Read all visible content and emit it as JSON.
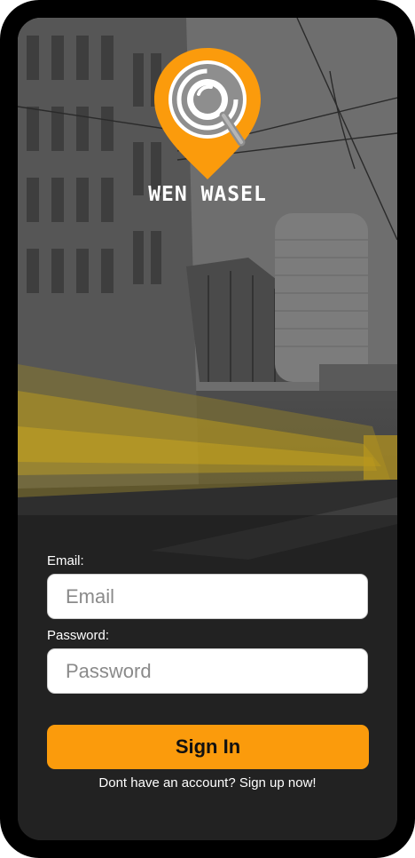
{
  "brand": {
    "name": "WEN WASEL",
    "logo_icon": "location-pin-search-icon",
    "accent_color": "#fb9b0c"
  },
  "background": {
    "description_icon": "city-street-tram-photo"
  },
  "form": {
    "email_label": "Email:",
    "email_placeholder": "Email",
    "password_label": "Password:",
    "password_placeholder": "Password",
    "submit_label": "Sign In"
  },
  "footer": {
    "signup_text": "Dont have an account? Sign up now!"
  }
}
